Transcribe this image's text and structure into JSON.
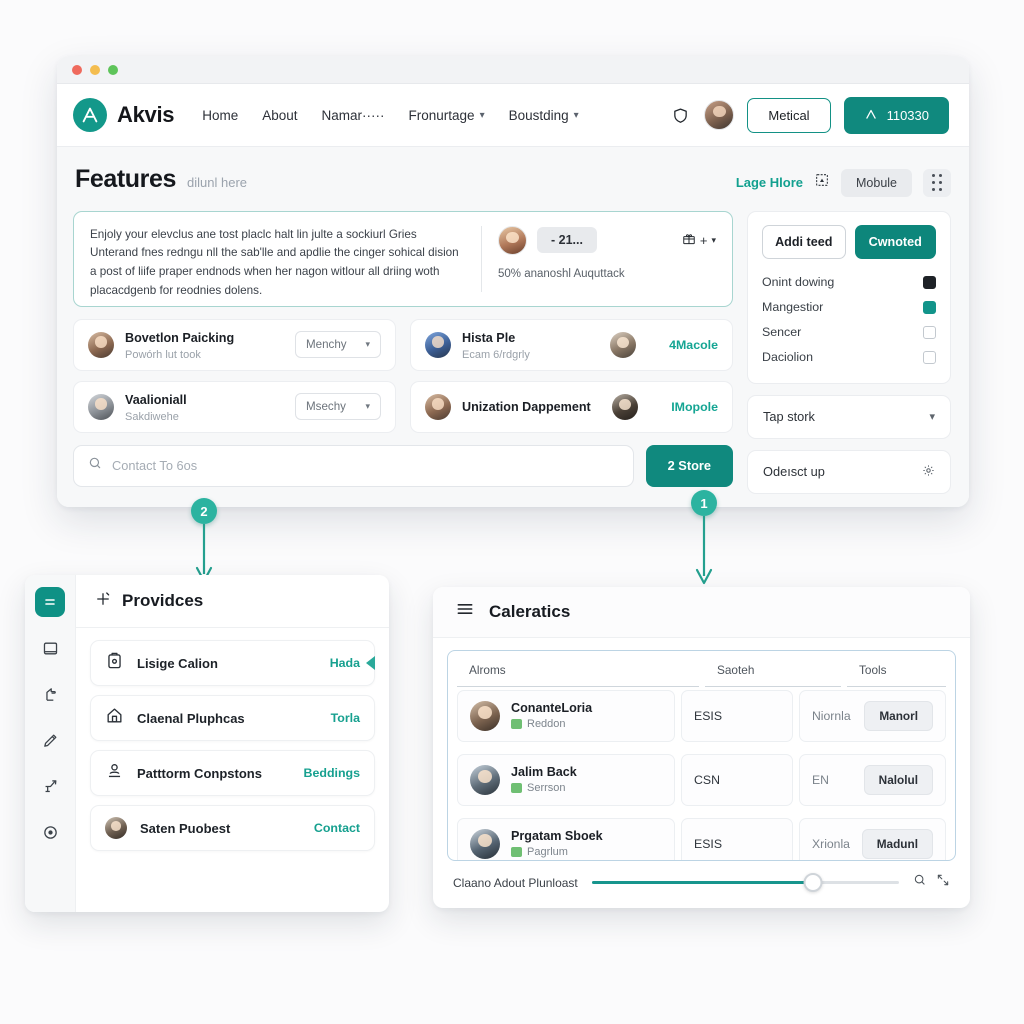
{
  "window": {
    "traffic_lights": [
      "close",
      "minimize",
      "maximize"
    ]
  },
  "navbar": {
    "brand": "Akvis",
    "links": [
      {
        "label": "Home",
        "has_caret": false
      },
      {
        "label": "About",
        "has_caret": false
      },
      {
        "label": "Namar·····",
        "has_caret": false
      },
      {
        "label": "Fronurtage",
        "has_caret": true
      },
      {
        "label": "Boustding",
        "has_caret": true
      }
    ],
    "shield_icon": "shield-icon",
    "avatar": "user-avatar",
    "outline_button": "Metical",
    "solid_button": "110330"
  },
  "page_header": {
    "title": "Features",
    "subtitle": "dilunl here",
    "link": "Lage Hlore",
    "link_icon": "frame-icon",
    "chip": "Mobule",
    "grid_icon": "grid-dots-icon"
  },
  "hero": {
    "paragraph": "Enjoly your elevclus ane tost placlc halt lin julte a sockiurl Gries Unterand fnes redngu nll the sab'lle and apdlie the cinger sohical dision a post of liife praper endnods when her nagon witlour all driing woth placacdgenb for reodnies dolens.",
    "pill": "- 21...",
    "gift_icon": "gift-icon",
    "plus_icon": "plus-icon",
    "caret_icon": "chevron-down-icon",
    "caption": "50% ananoshl Auquttack"
  },
  "list_left": [
    {
      "title": "Bovetlon Paicking",
      "sub": "Powórh lut took",
      "select": "Menchy"
    },
    {
      "title": "Vaalioniall",
      "sub": "Sakdiwehe",
      "select": "Msechy"
    }
  ],
  "list_right": [
    {
      "title": "Hista Ple",
      "sub": "Ecam 6/rdgrly",
      "link": "4Macole"
    },
    {
      "title": "Unization Dappement",
      "sub": "",
      "link": "IMopole"
    }
  ],
  "search": {
    "icon": "search-icon",
    "placeholder": "Contact To 6os",
    "button": "2 Store"
  },
  "side_panel": {
    "button_outline": "Addi teed",
    "button_solid": "Cwnoted",
    "checkboxes": [
      {
        "label": "Onint dowing",
        "state": "dark"
      },
      {
        "label": "Mangestior",
        "state": "teal"
      },
      {
        "label": "Sencer",
        "state": "empty"
      },
      {
        "label": "Daciolion",
        "state": "empty"
      }
    ],
    "dropdown": {
      "label": "Tap stork",
      "icon": "chevron-down-icon"
    },
    "settings_row": {
      "label": "Odeısct up",
      "icon": "gear-icon"
    }
  },
  "annotations": [
    {
      "number": "2"
    },
    {
      "number": "1"
    }
  ],
  "providers_panel": {
    "rail_icons": [
      "menu-equals-icon",
      "display-icon",
      "pointer-icon",
      "pencil-icon",
      "lamp-icon",
      "target-icon"
    ],
    "header_icon": "plus-sparkle-icon",
    "title": "Providces",
    "items": [
      {
        "icon": "clipboard-icon",
        "name": "Lisige Calion",
        "tag": "Hada",
        "selected": true
      },
      {
        "icon": "home-icon",
        "name": "Claenal Pluphcas",
        "tag": "Torla",
        "selected": false
      },
      {
        "icon": "person-pin-icon",
        "name": "Patttorm Conpstons",
        "tag": "Beddings",
        "selected": false
      },
      {
        "icon": "avatar",
        "name": "Saten Puobest",
        "tag": "Contact",
        "selected": false
      }
    ]
  },
  "table_panel": {
    "menu_icon": "hamburger-icon",
    "title": "Caleratics",
    "columns": [
      "Alroms",
      "Saoteh",
      "Tools"
    ],
    "rows": [
      {
        "name": "ConanteLoria",
        "sub": "Reddon",
        "col2": "ESIS",
        "col3": "Niornla",
        "action": "Manorl"
      },
      {
        "name": "Jalim Back",
        "sub": "Serrson",
        "col2": "CSN",
        "col3": "EN",
        "action": "Nalolul"
      },
      {
        "name": "Prgatam Sboek",
        "sub": "Pagrlum",
        "col2": "ESIS",
        "col3": "Xrionla",
        "action": "Madunl"
      }
    ],
    "footer": {
      "label": "Claano Adout Plunloast",
      "slider_percent": 72,
      "icons": [
        "zoom-out-icon",
        "expand-icon"
      ]
    }
  },
  "colors": {
    "accent": "#10897e",
    "accent_light": "#2cb3a0",
    "link": "#14a593",
    "page_bg": "#f7f8f9"
  }
}
